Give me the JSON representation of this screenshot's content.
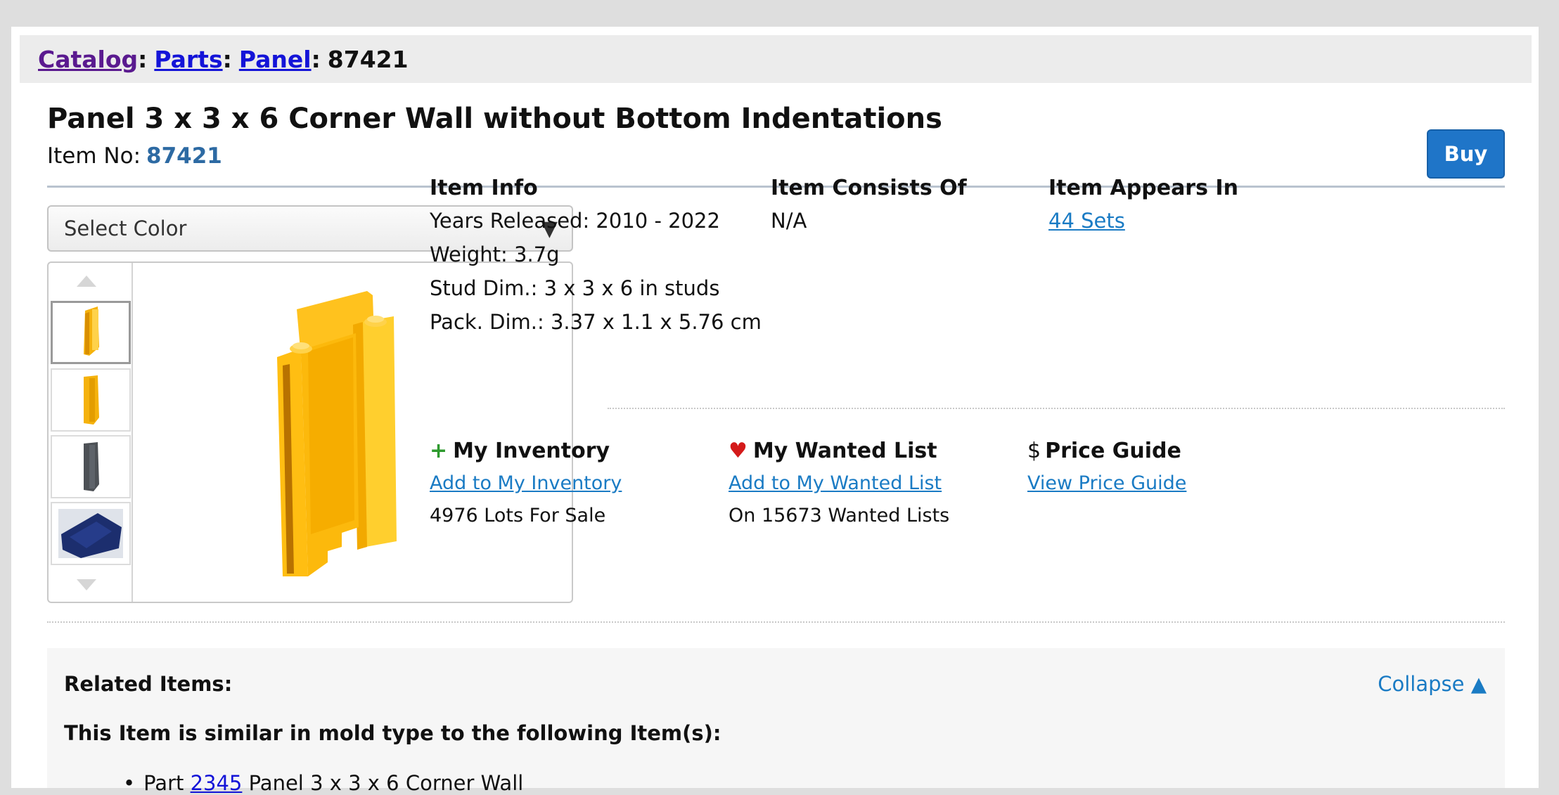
{
  "breadcrumb": {
    "catalog": "Catalog",
    "parts": "Parts",
    "panel": "Panel",
    "current": "87421",
    "separator": ":"
  },
  "item": {
    "title": "Panel 3 x 3 x 6 Corner Wall without Bottom Indentations",
    "item_no_label": "Item No:",
    "item_no": "87421",
    "buy_label": "Buy"
  },
  "color_select": {
    "selected": "Select Color",
    "arrow": "▼"
  },
  "gallery": {
    "thumbnails": [
      {
        "color": "#f5b20c",
        "icon": "yellow-panel-front-thumb"
      },
      {
        "color": "#f5b20c",
        "icon": "yellow-panel-back-thumb"
      },
      {
        "color": "#4d5156",
        "icon": "dark-gray-panel-thumb"
      },
      {
        "color": "#1c2e6e",
        "icon": "dark-blue-panel-thumb"
      }
    ],
    "main_color": "#ffbd1c"
  },
  "item_info": {
    "heading": "Item Info",
    "years": "Years Released: 2010 - 2022",
    "weight": "Weight: 3.7g",
    "stud_dim": "Stud Dim.: 3 x 3 x 6 in studs",
    "pack_dim": "Pack. Dim.: 3.37 x 1.1 x 5.76 cm"
  },
  "consists_of": {
    "heading": "Item Consists Of",
    "value": "N/A"
  },
  "appears_in": {
    "heading": "Item Appears In",
    "link": "44 Sets"
  },
  "inventory": {
    "icon": "+",
    "heading": "My Inventory",
    "link": "Add to My Inventory",
    "stat": "4976 Lots For Sale"
  },
  "wanted": {
    "icon": "♥",
    "heading": "My Wanted List",
    "link": "Add to My Wanted List",
    "stat": "On 15673 Wanted Lists"
  },
  "price_guide": {
    "icon": "$",
    "heading": "Price Guide",
    "link": "View Price Guide"
  },
  "related": {
    "heading": "Related Items:",
    "collapse": "Collapse ▲",
    "subheading": "This Item is similar in mold type to the following Item(s):",
    "items": [
      {
        "prefix": "Part",
        "part_no": "2345",
        "name": "Panel 3 x 3 x 6 Corner Wall"
      }
    ]
  }
}
